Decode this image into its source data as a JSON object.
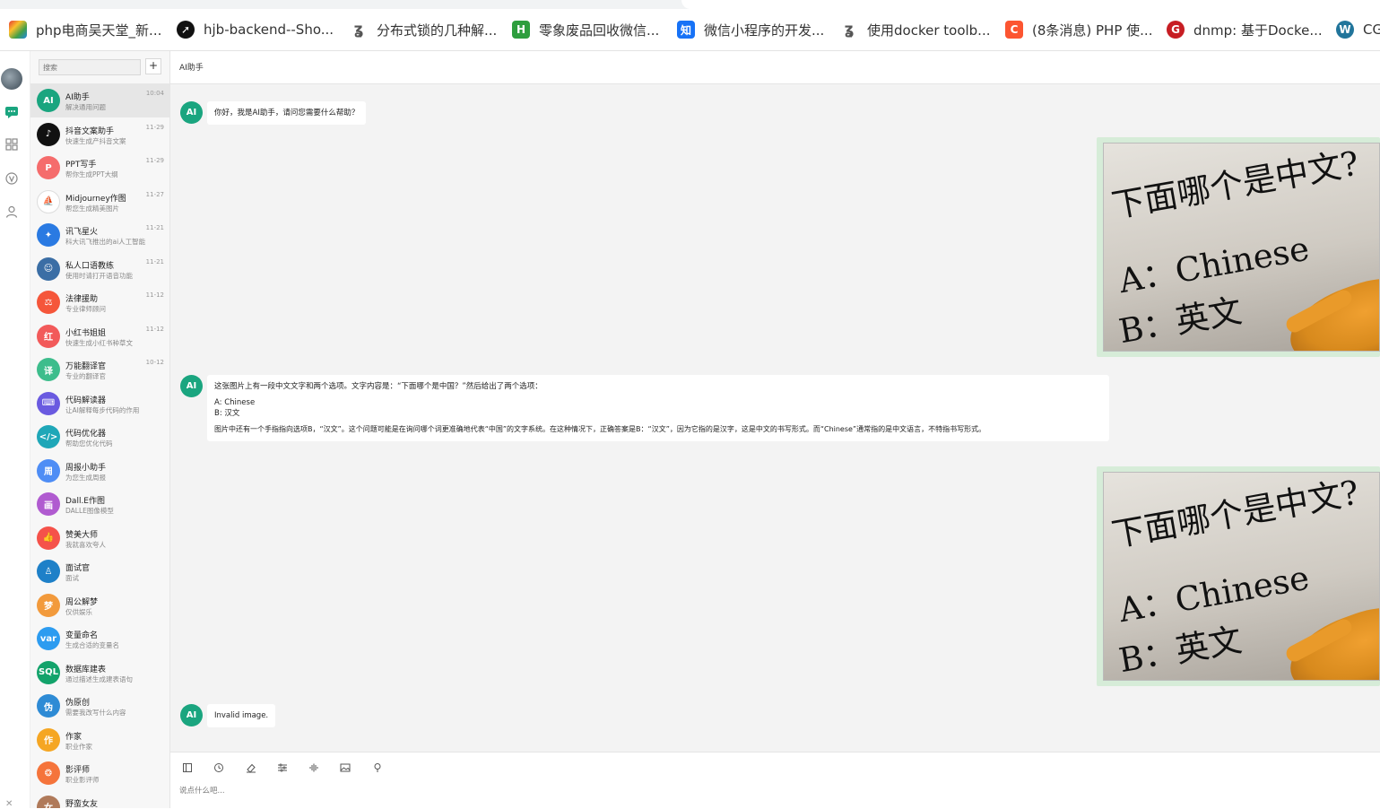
{
  "bookmarks": [
    {
      "label": "php电商吴天堂_新...",
      "icon": "rainbow-logo-icon",
      "color": "#e53935"
    },
    {
      "label": "hjb-backend--Sho...",
      "icon": "compass-icon",
      "color": "#111111"
    },
    {
      "label": "分布式锁的几种解...",
      "icon": "feather-icon",
      "color": "#555555"
    },
    {
      "label": "零象废品回收微信...",
      "icon": "h-logo-icon",
      "color": "#2e9e3e"
    },
    {
      "label": "微信小程序的开发...",
      "icon": "zhihu-icon",
      "color": "#1772f6"
    },
    {
      "label": "使用docker toolb...",
      "icon": "feather-icon",
      "color": "#555555"
    },
    {
      "label": "(8条消息) PHP 使...",
      "icon": "csdn-icon",
      "color": "#fc5531"
    },
    {
      "label": "dnmp: 基于Docke...",
      "icon": "gitee-icon",
      "color": "#c71d23"
    },
    {
      "label": "CG",
      "icon": "wordpress-icon",
      "color": "#21759b"
    }
  ],
  "sidebar": {
    "search_placeholder": "搜索",
    "add_label": "+",
    "items": [
      {
        "name": "AI助手",
        "desc": "解决通用问题",
        "time": "10:04",
        "badge": "AI",
        "color": "#1aa57f",
        "active": true
      },
      {
        "name": "抖音文案助手",
        "desc": "快速生成产抖音文案",
        "time": "11-29",
        "badge": "♪",
        "color": "#111111"
      },
      {
        "name": "PPT写手",
        "desc": "帮你生成PPT大纲",
        "time": "11-29",
        "badge": "P",
        "color": "#f56c6c"
      },
      {
        "name": "Midjourney作图",
        "desc": "帮您生成精美图片",
        "time": "11-27",
        "badge": "⛵",
        "color": "#ffffff"
      },
      {
        "name": "讯飞星火",
        "desc": "科大讯飞推出的ai人工智能",
        "time": "11-21",
        "badge": "✦",
        "color": "#2a7ae2"
      },
      {
        "name": "私人口语教练",
        "desc": "使用时请打开语音功能",
        "time": "11-21",
        "badge": "☺",
        "color": "#3b6ea5"
      },
      {
        "name": "法律援助",
        "desc": "专业律师顾问",
        "time": "11-12",
        "badge": "⚖",
        "color": "#f5563a"
      },
      {
        "name": "小红书姐姐",
        "desc": "快速生成小红书种草文",
        "time": "11-12",
        "badge": "红",
        "color": "#f25a5a"
      },
      {
        "name": "万能翻译官",
        "desc": "专业的翻译官",
        "time": "10-12",
        "badge": "译",
        "color": "#3dbd8c"
      },
      {
        "name": "代码解读器",
        "desc": "让AI解释每步代码的作用",
        "time": "",
        "badge": "⌨",
        "color": "#6a5ae0"
      },
      {
        "name": "代码优化器",
        "desc": "帮助您优化代码",
        "time": "",
        "badge": "</>",
        "color": "#1fa7b8"
      },
      {
        "name": "周报小助手",
        "desc": "为您生成周报",
        "time": "",
        "badge": "周",
        "color": "#4e8df5"
      },
      {
        "name": "Dall.E作图",
        "desc": "DALLE图像模型",
        "time": "",
        "badge": "画",
        "color": "#b05bd0"
      },
      {
        "name": "赞美大师",
        "desc": "我就喜欢夸人",
        "time": "",
        "badge": "👍",
        "color": "#f5524a"
      },
      {
        "name": "面试官",
        "desc": "面试",
        "time": "",
        "badge": "♙",
        "color": "#1e80c8"
      },
      {
        "name": "周公解梦",
        "desc": "仅供娱乐",
        "time": "",
        "badge": "梦",
        "color": "#f29a3c"
      },
      {
        "name": "变量命名",
        "desc": "生成合适的变量名",
        "time": "",
        "badge": "var",
        "color": "#2d9cf0"
      },
      {
        "name": "数据库建表",
        "desc": "通过描述生成建表语句",
        "time": "",
        "badge": "SQL",
        "color": "#13a36b"
      },
      {
        "name": "伪原创",
        "desc": "需要我改写什么内容",
        "time": "",
        "badge": "伪",
        "color": "#2e8bd5"
      },
      {
        "name": "作家",
        "desc": "职业作家",
        "time": "",
        "badge": "作",
        "color": "#f5a623"
      },
      {
        "name": "影评师",
        "desc": "职业影评师",
        "time": "",
        "badge": "❂",
        "color": "#f5743b"
      },
      {
        "name": "野蛮女友",
        "desc": "",
        "time": "",
        "badge": "女",
        "color": "#b07a5a"
      }
    ]
  },
  "chat": {
    "title": "AI助手",
    "assistant_badge": "AI",
    "messages": {
      "greeting": "你好，我是AI助手，请问您需要什么帮助？",
      "answer_line1": "这张图片上有一段中文文字和两个选项。文字内容是：“下面哪个是中国？”然后给出了两个选项：",
      "answer_line2": "A: Chinese",
      "answer_line3": "B: 汉文",
      "answer_line4": "图片中还有一个手指指向选项B，“汉文”。这个问题可能是在询问哪个词更准确地代表“中国”的文字系统。在这种情况下，正确答案是B：“汉文”，因为它指的是汉字，这是中文的书写形式。而“Chinese”通常指的是中文语言，不特指书写形式。",
      "invalid": "Invalid image."
    },
    "image_text": {
      "line1": "下面哪个是中文?",
      "line2": "A：Chinese",
      "line3": "B：英文"
    }
  },
  "input": {
    "placeholder": "说点什么吧..."
  }
}
